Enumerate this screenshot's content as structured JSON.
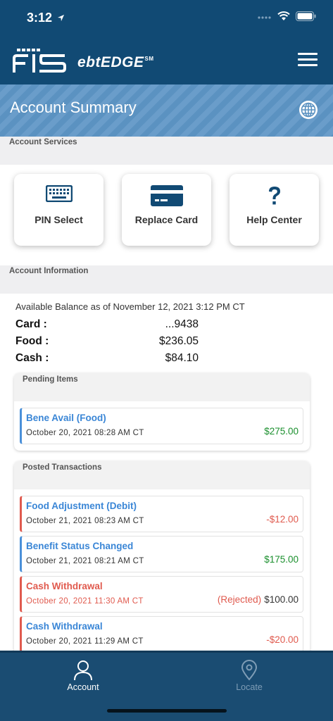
{
  "status_bar": {
    "time": "3:12"
  },
  "header": {
    "logo_text": "FIS",
    "brand": "ebtEDGE",
    "brand_mark": "SM"
  },
  "title_bar": {
    "title": "Account Summary"
  },
  "account_services": {
    "label": "Account Services",
    "tiles": [
      {
        "label": "PIN Select",
        "icon": "keyboard-icon"
      },
      {
        "label": "Replace Card",
        "icon": "credit-card-icon"
      },
      {
        "label": "Help Center",
        "icon": "question-icon"
      }
    ]
  },
  "account_information": {
    "label": "Account Information",
    "as_of": "Available Balance as of November 12, 2021 3:12 PM CT",
    "rows": [
      {
        "label": "Card :",
        "value": "...9438"
      },
      {
        "label": "Food :",
        "value": "$236.05"
      },
      {
        "label": "Cash :",
        "value": "$84.10"
      }
    ]
  },
  "pending": {
    "label": "Pending Items",
    "items": [
      {
        "title": "Bene Avail (Food)",
        "date": "October 20, 2021 08:28 AM CT",
        "amount": "$275.00"
      }
    ]
  },
  "posted": {
    "label": "Posted Transactions",
    "items": [
      {
        "title": "Food Adjustment (Debit)",
        "date": "October 21, 2021 08:23 AM CT",
        "amount": "-$12.00"
      },
      {
        "title": "Benefit Status Changed",
        "date": "October 21, 2021 08:21 AM CT",
        "amount": "$175.00"
      },
      {
        "title": "Cash Withdrawal",
        "date": "October 20, 2021 11:30 AM CT",
        "status": "(Rejected)",
        "amount": "$100.00"
      },
      {
        "title": "Cash Withdrawal",
        "date": "October 20, 2021 11:29 AM CT",
        "amount": "-$20.00"
      }
    ]
  },
  "tabbar": {
    "tabs": [
      {
        "label": "Account",
        "icon": "person-icon",
        "active": true
      },
      {
        "label": "Locate",
        "icon": "location-pin-icon",
        "active": false
      }
    ]
  },
  "colors": {
    "header_bg": "#114a74",
    "title_bar_bg": "#5b92c1",
    "link_blue": "#3a86d6",
    "positive_green": "#1a8f2d",
    "negative_red": "#e05a4e",
    "tabbar_bg": "#1a4c72"
  }
}
